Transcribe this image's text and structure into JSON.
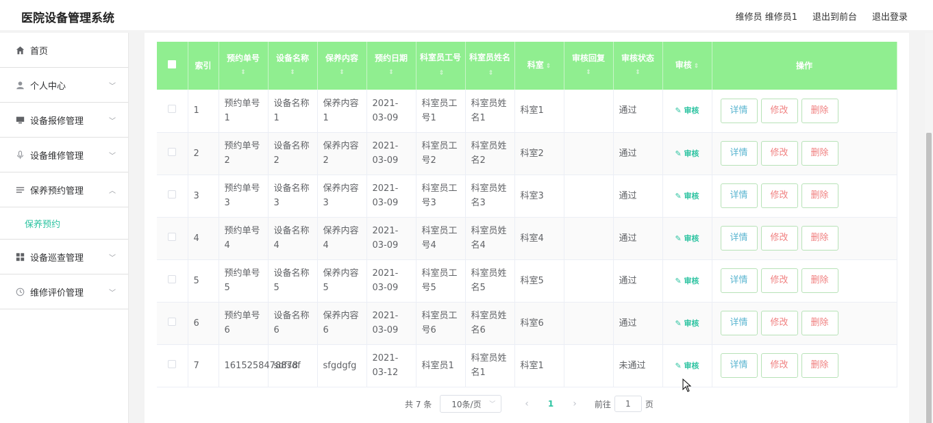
{
  "header": {
    "app_title": "医院设备管理系统",
    "user_label": "维修员 维修员1",
    "back_label": "退出到前台",
    "logout_label": "退出登录"
  },
  "sidebar": {
    "items": [
      {
        "label": "首页",
        "icon": "home-icon"
      },
      {
        "label": "个人中心",
        "icon": "user-icon"
      },
      {
        "label": "设备报修管理",
        "icon": "monitor-icon"
      },
      {
        "label": "设备维修管理",
        "icon": "microphone-icon"
      },
      {
        "label": "保养预约管理",
        "icon": "list-icon"
      },
      {
        "label": "设备巡查管理",
        "icon": "grid-icon"
      },
      {
        "label": "维修评价管理",
        "icon": "clock-icon"
      }
    ],
    "active_sub": "保养预约"
  },
  "table": {
    "columns": [
      "索引",
      "预约单号",
      "设备名称",
      "保养内容",
      "预约日期",
      "科室员工号",
      "科室员姓名",
      "科室",
      "审核回复",
      "审核状态",
      "审核",
      "操作"
    ],
    "rows": [
      {
        "index": "1",
        "order": "预约单号1",
        "device": "设备名称1",
        "content": "保养内容1",
        "date": "2021-03-09",
        "emp_no": "科室员工号1",
        "emp_name": "科室员姓名1",
        "dept": "科室1",
        "reply": "",
        "status": "通过"
      },
      {
        "index": "2",
        "order": "预约单号2",
        "device": "设备名称2",
        "content": "保养内容2",
        "date": "2021-03-09",
        "emp_no": "科室员工号2",
        "emp_name": "科室员姓名2",
        "dept": "科室2",
        "reply": "",
        "status": "通过"
      },
      {
        "index": "3",
        "order": "预约单号3",
        "device": "设备名称3",
        "content": "保养内容3",
        "date": "2021-03-09",
        "emp_no": "科室员工号3",
        "emp_name": "科室员姓名3",
        "dept": "科室3",
        "reply": "",
        "status": "通过"
      },
      {
        "index": "4",
        "order": "预约单号4",
        "device": "设备名称4",
        "content": "保养内容4",
        "date": "2021-03-09",
        "emp_no": "科室员工号4",
        "emp_name": "科室员姓名4",
        "dept": "科室4",
        "reply": "",
        "status": "通过"
      },
      {
        "index": "5",
        "order": "预约单号5",
        "device": "设备名称5",
        "content": "保养内容5",
        "date": "2021-03-09",
        "emp_no": "科室员工号5",
        "emp_name": "科室员姓名5",
        "dept": "科室5",
        "reply": "",
        "status": "通过"
      },
      {
        "index": "6",
        "order": "预约单号6",
        "device": "设备名称6",
        "content": "保养内容6",
        "date": "2021-03-09",
        "emp_no": "科室员工号6",
        "emp_name": "科室员姓名6",
        "dept": "科室6",
        "reply": "",
        "status": "通过"
      },
      {
        "index": "7",
        "order": "1615258478878",
        "device": "sdfsdf",
        "content": "sfgdgfg",
        "date": "2021-03-12",
        "emp_no": "科室员1",
        "emp_name": "科室员姓名1",
        "dept": "科室1",
        "reply": "",
        "status": "未通过"
      }
    ],
    "audit_label": "审核",
    "btn_detail": "详情",
    "btn_edit": "修改",
    "btn_delete": "删除"
  },
  "pagination": {
    "total": "共 7 条",
    "page_size": "10条/页",
    "current": "1",
    "goto_prefix": "前往",
    "goto_value": "1",
    "goto_suffix": "页"
  },
  "colors": {
    "accent": "#2dc3a1",
    "header_bg": "#90ee90"
  }
}
